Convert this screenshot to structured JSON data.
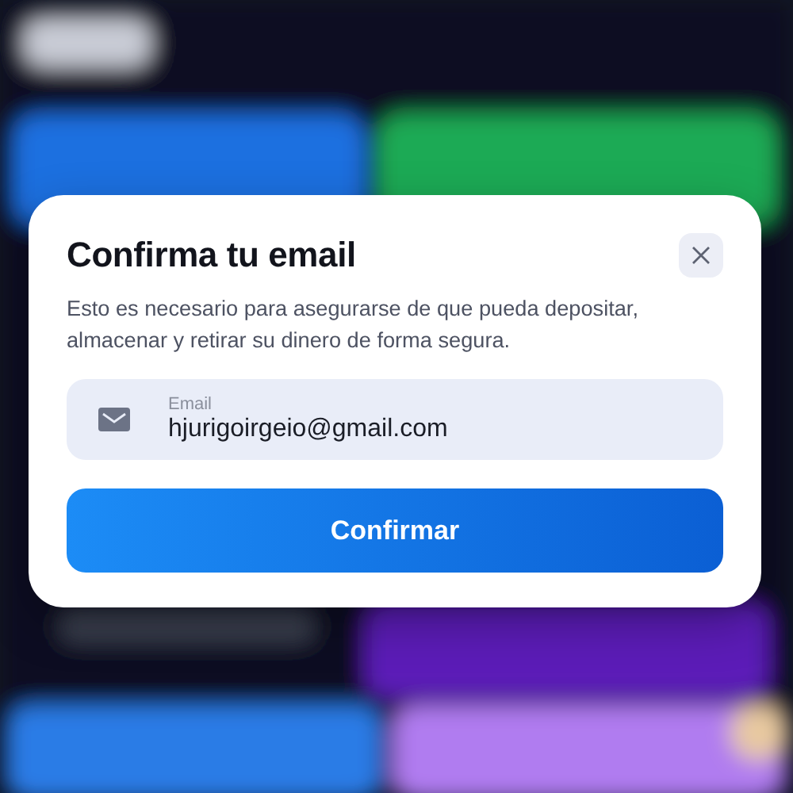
{
  "dialog": {
    "title": "Confirma tu email",
    "description": "Esto es necesario para asegurarse de que pueda depositar, almacenar y retirar su dinero de forma segura.",
    "email_field": {
      "label": "Email",
      "value": "hjurigoirgeio@gmail.com"
    },
    "confirm_button": {
      "label": "Confirmar"
    }
  }
}
